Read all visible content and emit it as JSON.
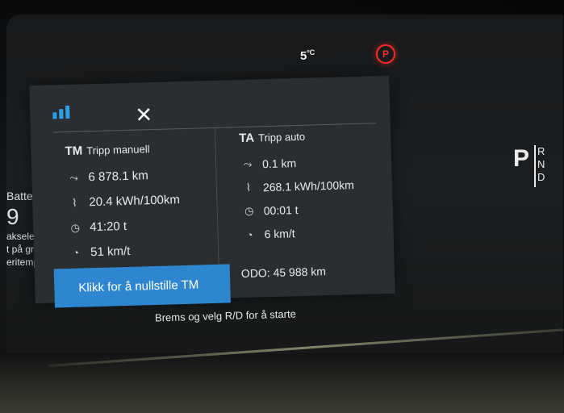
{
  "status": {
    "temperature": "5",
    "temperature_unit": "ºC",
    "parking_brake_label": "P"
  },
  "gear": {
    "current": "P",
    "options": "R N D"
  },
  "left_edge": {
    "line1": "Batter",
    "big_value": "9",
    "line2": "akseler",
    "line3": "t på gru",
    "line4": "eritempe"
  },
  "panel": {
    "trip_manual": {
      "abbr": "TM",
      "name": "Tripp manuell",
      "distance": "6 878.1 km",
      "consumption": "20.4 kWh/100km",
      "time": "41:20 t",
      "avg_speed": "51 km/t"
    },
    "trip_auto": {
      "abbr": "TA",
      "name": "Tripp auto",
      "distance": "0.1 km",
      "consumption": "268.1 kWh/100km",
      "time": "00:01 t",
      "avg_speed": "6 km/t"
    },
    "reset_button": "Klikk for å nullstille TM",
    "odometer": "ODO: 45 988 km"
  },
  "footer": {
    "message": "Brems og velg R/D for å starte"
  },
  "colors": {
    "accent": "#2e86d0",
    "warning": "#ff2a2a",
    "panel_bg": "#2b2e31"
  },
  "icons": [
    "stats-icon",
    "close-icon",
    "route-icon",
    "consumption-icon",
    "clock-icon",
    "speed-icon",
    "parking-brake-icon"
  ]
}
